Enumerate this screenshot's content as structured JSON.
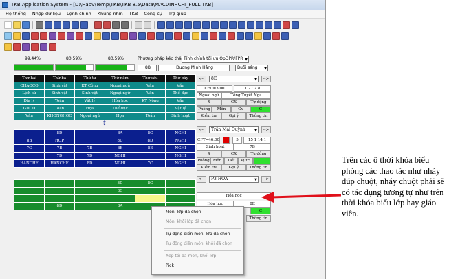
{
  "window": {
    "title": "TKB Application System - [D:\\Habv\\Temp\\TKB\\TKB 8.5\\Data\\MACDINHCHI_FULL.TKB]"
  },
  "menu": [
    "Hệ thống",
    "Nhập dữ liệu",
    "Lệnh chính",
    "Khung nhìn",
    "TKB",
    "Công cụ",
    "Trợ giúp"
  ],
  "progress": [
    {
      "label": "99.44%",
      "value": 99.44
    },
    {
      "label": "80.59%",
      "value": 80.59
    },
    {
      "label": "80.59%",
      "value": 80.59
    }
  ],
  "class_label": "8B",
  "teacher_label": "Dương Minh Hằng",
  "method_label": "Phương pháp kéo thả:",
  "method_value": "Tính chính tối ưu OpDPR/FPR",
  "session_value": "Buổi sáng",
  "teal_grid": {
    "headers": [
      "Thứ hai",
      "Thứ ba",
      "Thứ tư",
      "Thứ năm",
      "Thứ sáu",
      "Thứ bảy"
    ],
    "rows": [
      [
        "CHAOCO",
        "Sinh vật",
        "KT Công",
        "Ngoại ngữ",
        "Văn",
        "Văn"
      ],
      [
        "Lịch sử",
        "Sinh vật",
        "Sinh vật",
        "Ngoại ngữ",
        "Văn",
        "Thể dục"
      ],
      [
        "Địa lý",
        "Toán",
        "Vật lý",
        "Hóa học",
        "KT Nông",
        "Văn"
      ],
      [
        "GDCD",
        "Toán",
        "Họa",
        "Thể dục",
        "",
        "Vật lý"
      ],
      [
        "Văn",
        "KHONGHOC",
        "Ngoại ngữ",
        "Họa",
        "Toán",
        "Sinh hoạt"
      ]
    ]
  },
  "blue_grid": {
    "rows": [
      [
        "",
        "8D",
        "",
        "8A",
        "8C",
        "NGHI"
      ],
      [
        "8B",
        "HOP",
        "",
        "8D",
        "8D",
        "NGHI"
      ],
      [
        "7C",
        "7B",
        "7B",
        "8E",
        "8E",
        "NGHI"
      ],
      [
        "",
        "7D",
        "7D",
        "NGHI",
        "",
        "NGHI"
      ],
      [
        "HANCHE",
        "HANCHE",
        "8D",
        "NGHI",
        "7C",
        "NGHI"
      ]
    ]
  },
  "green_grid": {
    "rows": [
      [
        "",
        "",
        "",
        "8D",
        "8C",
        ""
      ],
      [
        "",
        "",
        "",
        "8C",
        "",
        ""
      ],
      [
        "",
        "",
        "",
        "",
        "",
        ""
      ],
      [
        "",
        "8D",
        "",
        "8A",
        "",
        ""
      ]
    ]
  },
  "panel1": {
    "nav_prev": "<--",
    "nav_next": "-->",
    "class": "8E",
    "cfc": "CFC=3.00",
    "code": "1 27 2 8",
    "subject": "Ngoại ngữ",
    "teacher": "Tống Tuyết Nga",
    "x": "X",
    "cx": "CX",
    "auto": "Tự động",
    "room": "Phòng",
    "mon": "Môn",
    "gv": "Gv",
    "c": "C",
    "check": "Kiểm tra",
    "suggest": "Gợi ý",
    "info": "Thông tin"
  },
  "panel2": {
    "nav_prev": "<--",
    "nav_next": "-->",
    "teacher": "Trần Mai Quỳnh",
    "cft": "CFT=46.00",
    "num": "5",
    "code": "15 1 14 1",
    "subject": "Sinh hoạt",
    "class": "7B",
    "x": "X",
    "cx": "CX",
    "auto": "Tự động",
    "room": "Phòng",
    "mon": "Môn",
    "tiet": "Tiết",
    "vitri": "Vị trí",
    "c": "C",
    "check": "Kiểm tra",
    "suggest": "Gợi ý",
    "info": "Thông tin"
  },
  "panel3": {
    "nav_prev": "<--",
    "nav_next": "-->",
    "room": "P3-HOA",
    "subject": "Hóa học",
    "subject2": "Hóa học",
    "class": "8E",
    "c": "C",
    "info": "Thông tin"
  },
  "context_menu": {
    "items": [
      {
        "label": "Môn, lớp đã chọn",
        "enabled": true
      },
      {
        "label": "Môn, khối lớp đã chọn",
        "enabled": false
      },
      {
        "label": "Tự động điền môn, lớp đã chọn",
        "enabled": true
      },
      {
        "label": "Tự động điền môn, khối đã chọn",
        "enabled": false
      },
      {
        "label": "Xếp tối đa môn, khối lớp",
        "enabled": false
      },
      {
        "label": "Pick",
        "enabled": true
      }
    ]
  },
  "callout": "Trên các ô thời khóa biểu phòng các thao tác như nháy đúp chuột, nháy chuột phải sẽ có tác dụng tương tự như trên thời khóa biểu lớp hay giáo viên.",
  "colors": {
    "teal": "#0f8a8a",
    "blue": "#0b1f8e",
    "green": "#178c2c",
    "progress_fill": "#17b317",
    "callout_arrow": "#e0101a"
  }
}
